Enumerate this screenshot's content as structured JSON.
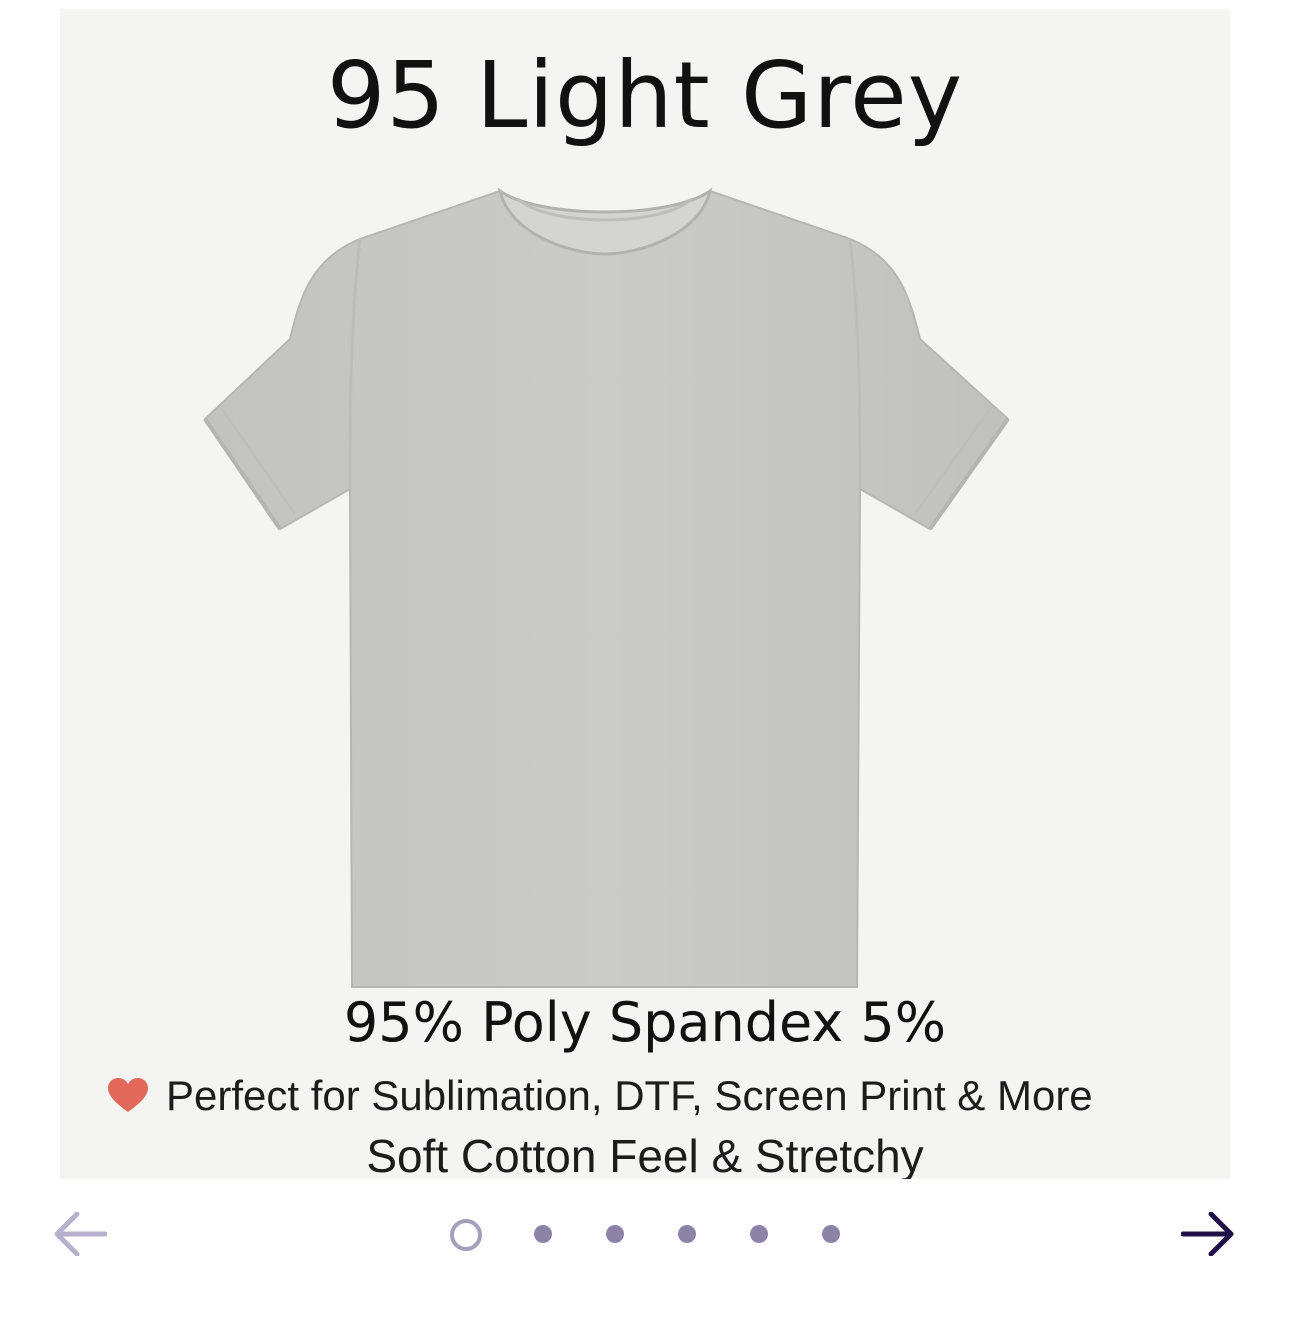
{
  "product_image": {
    "title": "95 Light Grey",
    "fabric": "95% Poly Spandex 5%",
    "feature_1": "Perfect for Sublimation, DTF, Screen Print & More",
    "feature_2": "Soft Cotton Feel & Stretchy",
    "heart_icon": "heart-icon",
    "shirt_color": "#c9c9c7"
  },
  "carousel": {
    "prev_icon": "arrow-left-icon",
    "next_icon": "arrow-right-icon",
    "prev_color": "#b7b0cc",
    "next_color": "#1f1147",
    "slide_count": 6,
    "active_index": 0
  }
}
